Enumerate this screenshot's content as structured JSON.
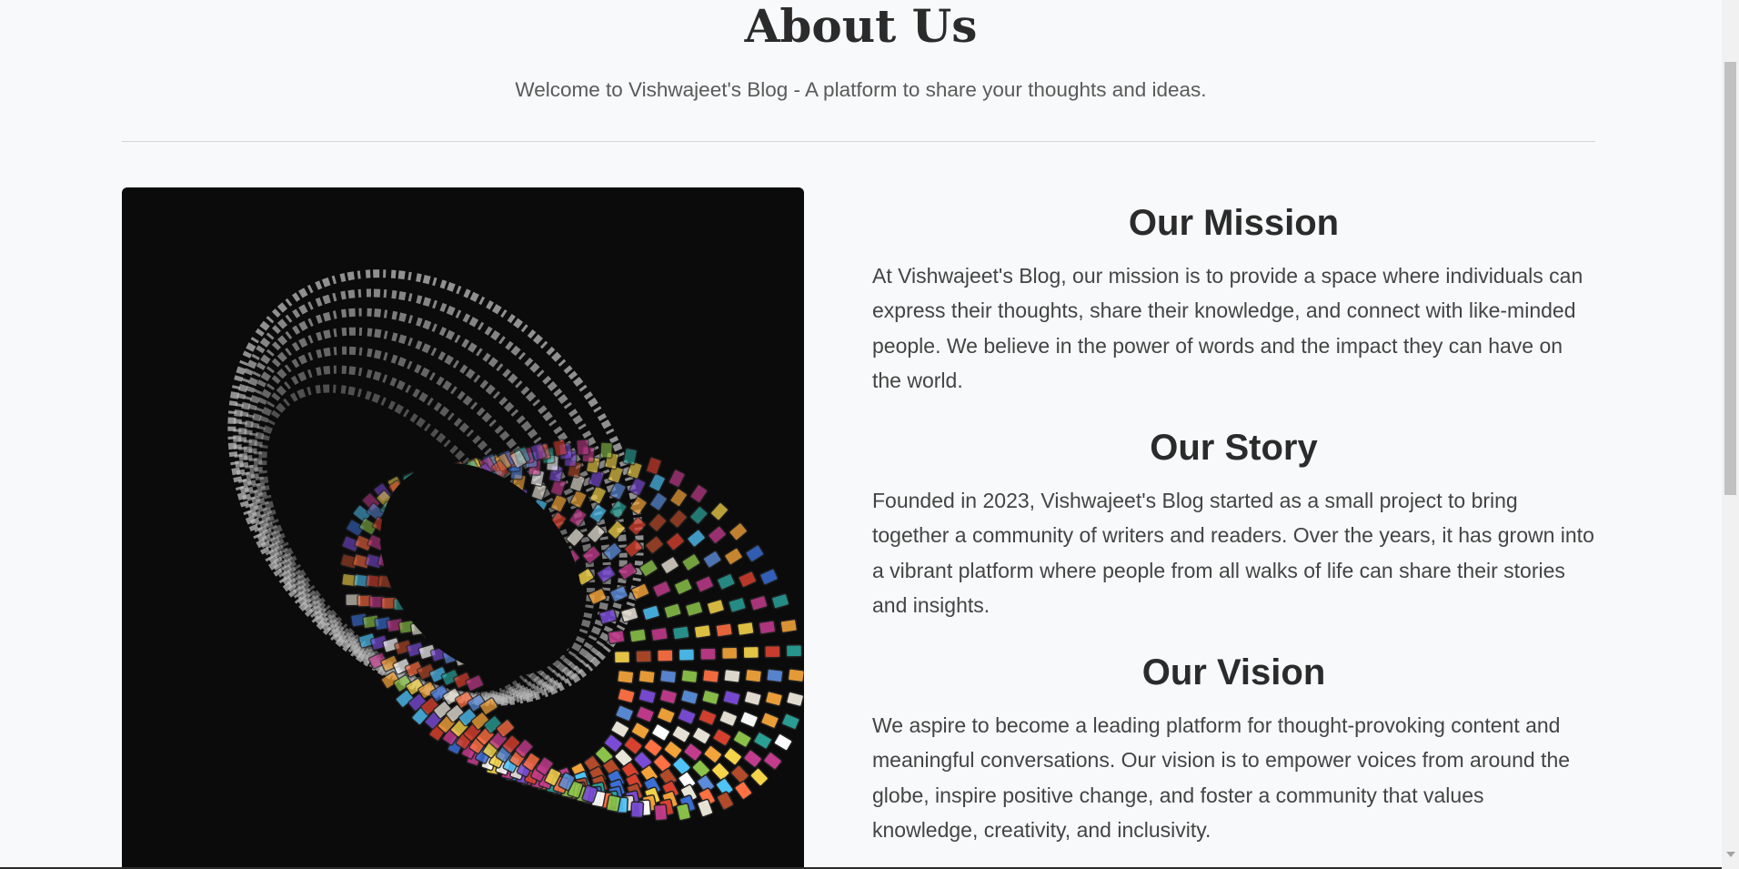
{
  "header": {
    "title": "About Us",
    "subtitle": "Welcome to Vishwajeet's Blog - A platform to share your thoughts and ideas."
  },
  "hero_image": {
    "alt": "Cylinder of image tiles with text spiraling around it"
  },
  "sections": [
    {
      "title": "Our Mission",
      "body": "At Vishwajeet's Blog, our mission is to provide a space where individuals can express their thoughts, share their knowledge, and connect with like-minded people. We believe in the power of words and the impact they can have on the world."
    },
    {
      "title": "Our Story",
      "body": "Founded in 2023, Vishwajeet's Blog started as a small project to bring together a community of writers and readers. Over the years, it has grown into a vibrant platform where people from all walks of life can share their stories and insights."
    },
    {
      "title": "Our Vision",
      "body": "We aspire to become a leading platform for thought-provoking content and meaningful conversations. Our vision is to empower voices from around the globe, inspire positive change, and foster a community that values knowledge, creativity, and inclusivity."
    }
  ],
  "colors": {
    "page_background": "#f8f9fa",
    "heading": "#2b2b2b",
    "body_text": "#444444",
    "image_background": "#0b0b0b"
  }
}
